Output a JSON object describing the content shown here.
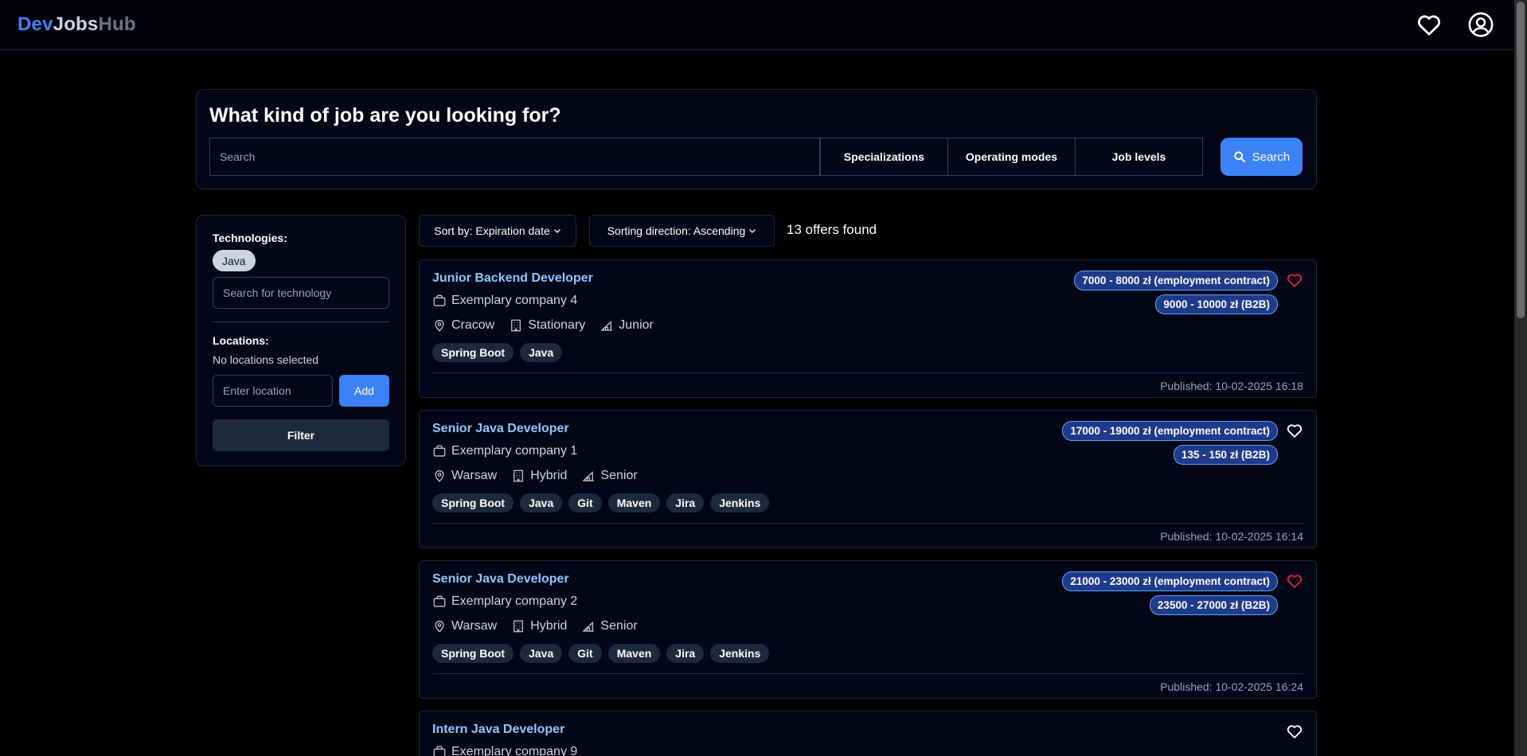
{
  "header": {
    "logo_part1": "Dev",
    "logo_part2": "Jobs",
    "logo_part3": "Hub"
  },
  "search": {
    "title": "What kind of job are you looking for?",
    "placeholder": "Search",
    "specializations_label": "Specializations",
    "operating_modes_label": "Operating modes",
    "job_levels_label": "Job levels",
    "search_button_label": "Search"
  },
  "filters": {
    "technologies_label": "Technologies:",
    "selected_technology": "Java",
    "technology_placeholder": "Search for technology",
    "locations_label": "Locations:",
    "no_locations": "No locations selected",
    "location_placeholder": "Enter location",
    "add_label": "Add",
    "filter_label": "Filter"
  },
  "results": {
    "sort_by_label": "Sort by: Expiration date",
    "sort_direction_label": "Sorting direction: Ascending",
    "offers_count": "13 offers found"
  },
  "offers": [
    {
      "title": "Junior Backend Developer",
      "company": "Exemplary company 4",
      "location": "Cracow",
      "mode": "Stationary",
      "level": "Junior",
      "tags": [
        "Spring Boot",
        "Java"
      ],
      "salaries": [
        "7000 - 8000 zł (employment contract)",
        "9000 - 10000 zł (B2B)"
      ],
      "published": "Published: 10-02-2025 16:18",
      "favorite": true
    },
    {
      "title": "Senior Java Developer",
      "company": "Exemplary company 1",
      "location": "Warsaw",
      "mode": "Hybrid",
      "level": "Senior",
      "tags": [
        "Spring Boot",
        "Java",
        "Git",
        "Maven",
        "Jira",
        "Jenkins"
      ],
      "salaries": [
        "17000 - 19000 zł (employment contract)",
        "135 - 150 zł (B2B)"
      ],
      "published": "Published: 10-02-2025 16:14",
      "favorite": false
    },
    {
      "title": "Senior Java Developer",
      "company": "Exemplary company 2",
      "location": "Warsaw",
      "mode": "Hybrid",
      "level": "Senior",
      "tags": [
        "Spring Boot",
        "Java",
        "Git",
        "Maven",
        "Jira",
        "Jenkins"
      ],
      "salaries": [
        "21000 - 23000 zł (employment contract)",
        "23500 - 27000 zł (B2B)"
      ],
      "published": "Published: 10-02-2025 16:24",
      "favorite": true
    },
    {
      "title": "Intern Java Developer",
      "company": "Exemplary company 9",
      "favorite": false
    }
  ],
  "colors": {
    "accent": "#3b82f6",
    "heart_favorite": "#e11d48",
    "heart_default": "#ffffff"
  },
  "icons": {
    "favorites": "heart-icon",
    "account": "user-circle-icon",
    "search": "search-icon",
    "company": "briefcase-icon",
    "location": "map-pin-icon",
    "mode": "building-icon",
    "level": "level-icon"
  }
}
